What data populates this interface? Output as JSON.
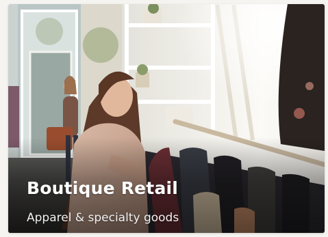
{
  "card": {
    "title": "Boutique Retail",
    "subtitle": "Apparel & specialty goods",
    "image_alt": "Woman browsing clothing rack in a bright boutique"
  },
  "colors": {
    "page_background": "#f6f4f1",
    "title_text": "#ffffff",
    "subtitle_text": "#f1f1f1"
  }
}
